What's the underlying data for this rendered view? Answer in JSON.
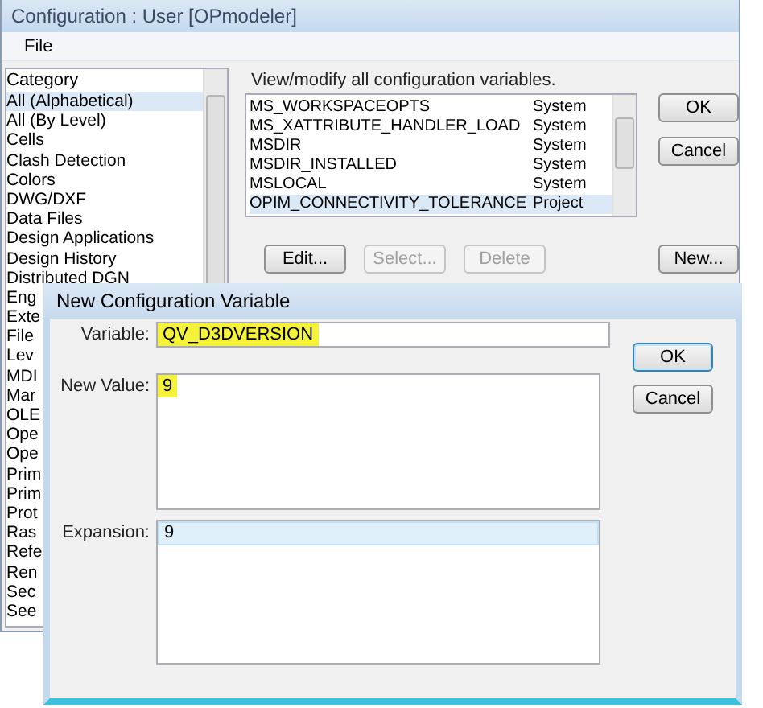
{
  "window": {
    "title": "Configuration : User [OPmodeler]"
  },
  "menu": [
    "File"
  ],
  "category": {
    "header": "Category",
    "items": [
      {
        "label": "All (Alphabetical)",
        "selected": true
      },
      {
        "label": "All (By Level)",
        "selected": false
      },
      {
        "label": "Cells",
        "selected": false
      },
      {
        "label": "Clash Detection",
        "selected": false
      },
      {
        "label": "Colors",
        "selected": false
      },
      {
        "label": "DWG/DXF",
        "selected": false
      },
      {
        "label": "Data Files",
        "selected": false
      },
      {
        "label": "Design Applications",
        "selected": false
      },
      {
        "label": "Design History",
        "selected": false
      },
      {
        "label": "Distributed DGN",
        "selected": false
      },
      {
        "label": "Eng",
        "selected": false
      },
      {
        "label": "Exte",
        "selected": false
      },
      {
        "label": "File",
        "selected": false
      },
      {
        "label": "Lev",
        "selected": false
      },
      {
        "label": "MDI",
        "selected": false
      },
      {
        "label": "Mar",
        "selected": false
      },
      {
        "label": "OLE",
        "selected": false
      },
      {
        "label": "Ope",
        "selected": false
      },
      {
        "label": "Ope",
        "selected": false
      },
      {
        "label": "Prim",
        "selected": false
      },
      {
        "label": "Prim",
        "selected": false
      },
      {
        "label": "Prot",
        "selected": false
      },
      {
        "label": "Ras",
        "selected": false
      },
      {
        "label": "Refe",
        "selected": false
      },
      {
        "label": "Ren",
        "selected": false
      },
      {
        "label": "Sec",
        "selected": false
      },
      {
        "label": "See",
        "selected": false
      }
    ]
  },
  "caption": "View/modify all configuration variables.",
  "variables": [
    {
      "name": "MS_WORKSPACEOPTS",
      "level": "System",
      "selected": false
    },
    {
      "name": "MS_XATTRIBUTE_HANDLER_LOAD",
      "level": "System",
      "selected": false
    },
    {
      "name": "MSDIR",
      "level": "System",
      "selected": false
    },
    {
      "name": "MSDIR_INSTALLED",
      "level": "System",
      "selected": false
    },
    {
      "name": "MSLOCAL",
      "level": "System",
      "selected": false
    },
    {
      "name": "OPIM_CONNECTIVITY_TOLERANCE",
      "level": "Project",
      "selected": true
    }
  ],
  "side_buttons": [
    {
      "label": "OK",
      "disabled": false
    },
    {
      "label": "Cancel",
      "disabled": false
    }
  ],
  "action_buttons": [
    {
      "label": "Edit...",
      "disabled": false
    },
    {
      "label": "Select...",
      "disabled": true
    },
    {
      "label": "Delete",
      "disabled": true
    }
  ],
  "new_button": {
    "label": "New...",
    "disabled": false
  },
  "dialog": {
    "title": "New Configuration Variable",
    "variable": {
      "label": "Variable:",
      "value": "QV_D3DVERSION",
      "highlighted": true
    },
    "new_value": {
      "label": "New Value:",
      "value": "9",
      "highlighted": true
    },
    "expansion": {
      "label": "Expansion:",
      "lines": [
        {
          "text": "9",
          "selected": true
        }
      ]
    },
    "buttons": [
      {
        "label": "OK",
        "default": true
      },
      {
        "label": "Cancel",
        "default": false
      }
    ]
  }
}
